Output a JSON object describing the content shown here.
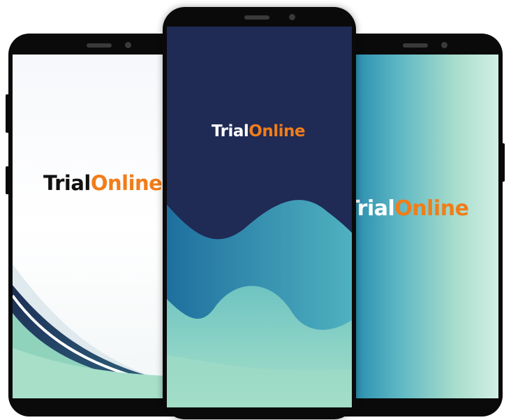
{
  "brand": {
    "part1": "Trial",
    "part2": "Online"
  },
  "colors": {
    "accent_orange": "#f07d1a",
    "navy": "#1f2a55",
    "teal": "#3fa3b8",
    "mint": "#8fd3bd",
    "phone_body": "#0a0a0a"
  },
  "phones": [
    {
      "name": "left-phone",
      "theme": "light-white-waves"
    },
    {
      "name": "center-phone",
      "theme": "navy-teal-waves"
    },
    {
      "name": "right-phone",
      "theme": "teal-gradient"
    }
  ]
}
